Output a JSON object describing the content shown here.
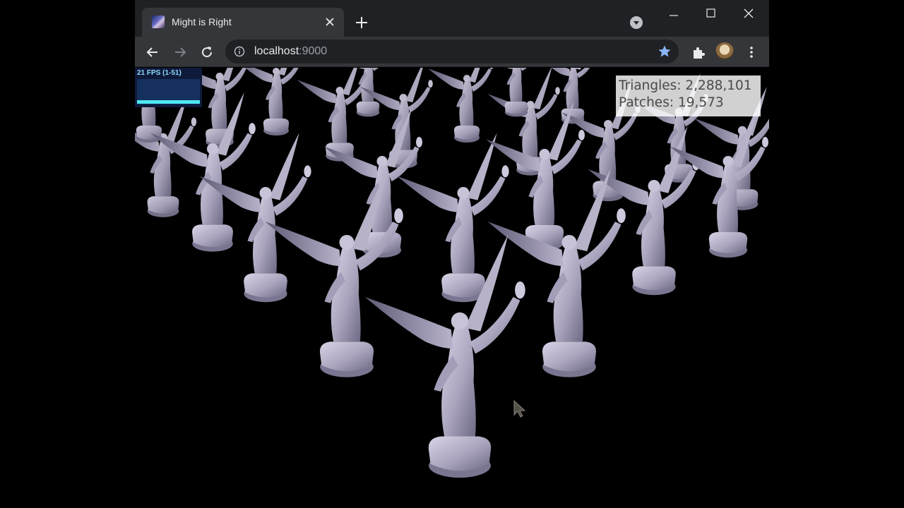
{
  "tab": {
    "title": "Might is Right"
  },
  "address_bar": {
    "host": "localhost",
    "port": ":9000"
  },
  "overlay": {
    "fps": "21 FPS (1-51)",
    "triangles": "Triangles: 2,288,101",
    "patches": "Patches: 19,573"
  },
  "icons": {
    "favicon": "favicon-icon",
    "close_tab": "close-icon",
    "new_tab": "plus-icon",
    "tab_search": "chevron-down-icon",
    "back": "arrow-left-icon",
    "forward": "arrow-right-icon",
    "reload": "reload-icon",
    "site_info": "info-icon",
    "bookmark": "star-icon",
    "extensions": "puzzle-icon",
    "menu": "kebab-icon"
  },
  "colors": {
    "bookmark_star": "#8ab4f8",
    "fps_bar": "#4fe7f2",
    "statue": "#b7b2c8"
  }
}
